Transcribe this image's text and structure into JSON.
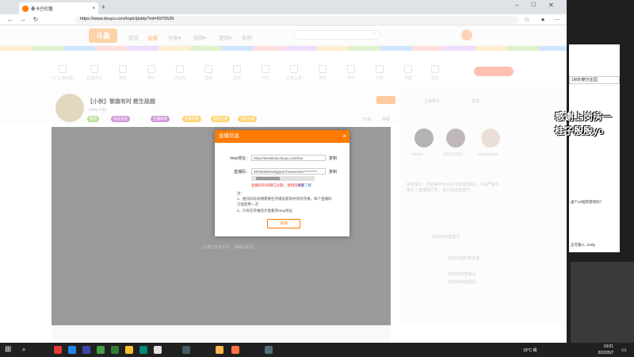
{
  "browser": {
    "tab_title": "秦卡巴伦盟",
    "url": "https://www.douyu.com/topic/jkddp?rid=6970539"
  },
  "site": {
    "logo": "斗鱼",
    "nav": [
      "首页",
      "直播",
      "分类▾",
      "视频▾",
      "游戏▾",
      "鱼吧"
    ]
  },
  "categories": [
    "12\n上海收视",
    "直播排行",
    "推荐",
    "排行",
    "节目表",
    "签到",
    "活动",
    "冲突",
    "主播之家",
    "发布",
    "排行",
    "节目",
    "地图",
    "更多"
  ],
  "room": {
    "title": "【小秋】黎旗有时 教生敌题",
    "host": "Sniily小秋",
    "follow_count": "关注",
    "pills": [
      "黎旗",
      "电竞竞技",
      "主播勋章",
      "荣誉勋章",
      "超级主播",
      "贡献主播"
    ],
    "share_label": "分享",
    "report_label": "举报"
  },
  "video": {
    "hint": "主播正在休息中，请稍后再试"
  },
  "right_panel": {
    "tab1": "主播排行",
    "tab2": "贵宾",
    "fans": [
      "wuxc4",
      "SP123ABC",
      "xxsdxbdnpr"
    ],
    "chat": [
      "系统提示：欢迎来到Sniily小秋的直播间。斗鱼严禁未成年人直播或打赏，请主播自觉遵守。",
      "欢迎来到直播间",
      "欢迎光临新奇直播",
      "欢迎来到直播间",
      "欢迎来到直播间"
    ]
  },
  "modal": {
    "title": "直播信息",
    "close_icon": "×",
    "rtmp_label": "rtmp地址：",
    "rtmp_value": "rtmp://sendtc3a.douyu.com/live",
    "key_label": "直播码：",
    "key_value": "6970539rlnxnfgQoHTxxSecrets**********",
    "copy_label": "复制",
    "warning": "直播码有效期已过期，请稍后刷新",
    "learn_more": "点此了解",
    "note_title": "注：",
    "note_1": "1、推流码有效期需要在开播前获取并及时开播，每个直播码只能使用一次",
    "note_2": "2、只有在开播后才能看到rtmp地址",
    "close_button": "关闭"
  },
  "desktop": {
    "overlay_line1": "感谢上岗房一",
    "overlay_line2": "桂子殷殷yo",
    "window_title": "1秋的摩尔庄园",
    "tip": "送个10给新游戏吗？",
    "footer": "正在输入: Sniily"
  },
  "taskbar": {
    "weather": "18°C 晴",
    "time": "19:01",
    "date": "2022/5/7"
  }
}
